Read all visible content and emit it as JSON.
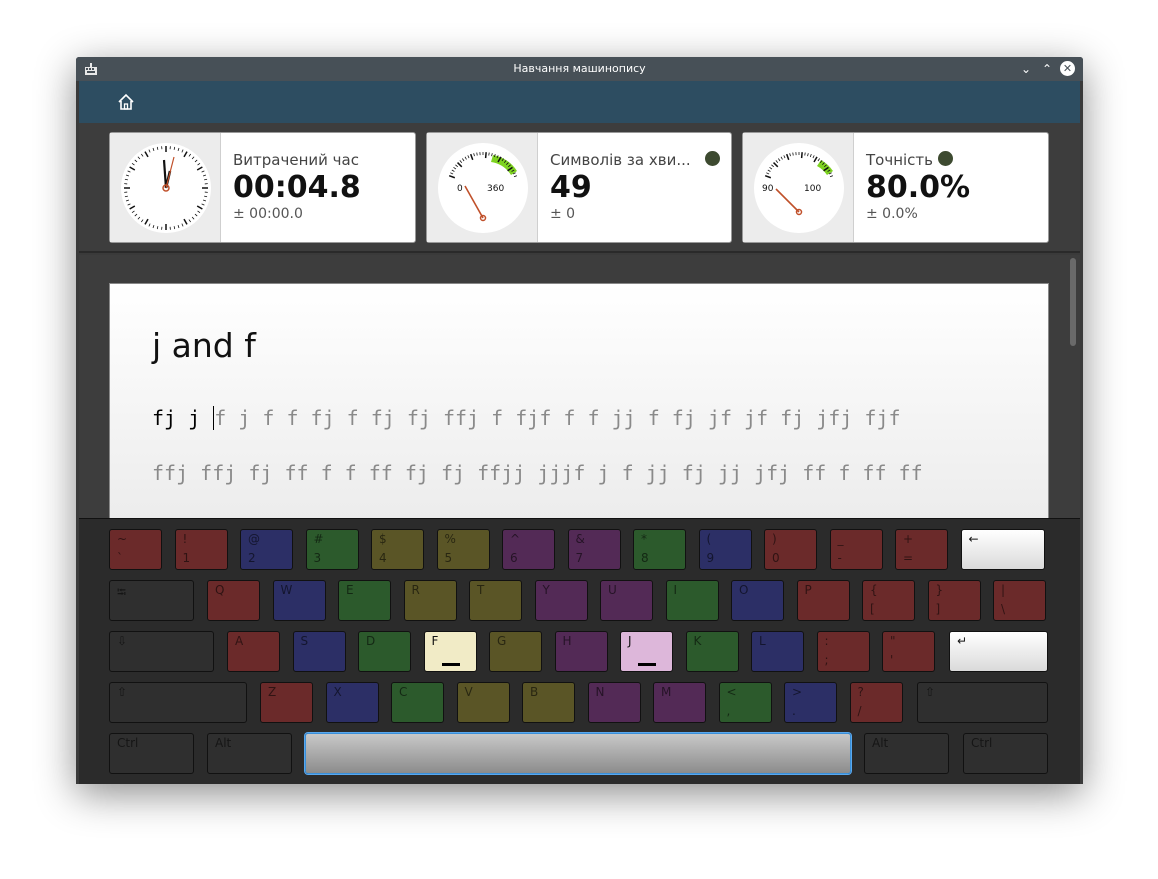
{
  "window": {
    "title": "Навчання машинопису",
    "controls": {
      "minimize": "⌄",
      "maximize": "⌃",
      "close": "✕"
    }
  },
  "toolbar": {
    "home_icon": "home-icon"
  },
  "stats": {
    "time": {
      "label": "Витрачений час",
      "value": "00:04.8",
      "deviation": "± 00:00.0"
    },
    "speed": {
      "label": "Символів за хви...",
      "value": "49",
      "deviation": "± 0",
      "gauge_min": "0",
      "gauge_max": "360"
    },
    "accuracy": {
      "label": "Точність",
      "value": "80.0%",
      "deviation": "± 0.0%",
      "gauge_min": "90",
      "gauge_max": "100"
    }
  },
  "lesson": {
    "title": "j and f",
    "typed": "fj j ",
    "remaining": "f j f f fj f fj fj ffj f fjf f f jj f fj jf jf fj jfj fjf",
    "line2": "ffj ffj fj ff f f ff fj fj ffjj jjjf j f jj fj jj jfj ff f ff ff"
  },
  "keyboard": {
    "row1": [
      {
        "t": "~",
        "b": "`"
      },
      {
        "t": "!",
        "b": "1"
      },
      {
        "t": "@",
        "b": "2"
      },
      {
        "t": "#",
        "b": "3"
      },
      {
        "t": "$",
        "b": "4"
      },
      {
        "t": "%",
        "b": "5"
      },
      {
        "t": "^",
        "b": "6"
      },
      {
        "t": "&",
        "b": "7"
      },
      {
        "t": "*",
        "b": "8"
      },
      {
        "t": "(",
        "b": "9"
      },
      {
        "t": ")",
        "b": "0"
      },
      {
        "t": "_",
        "b": "-"
      },
      {
        "t": "+",
        "b": "="
      },
      {
        "t": "←",
        "b": ""
      }
    ],
    "row2": [
      {
        "t": "⭾",
        "b": ""
      },
      {
        "t": "Q",
        "b": ""
      },
      {
        "t": "W",
        "b": ""
      },
      {
        "t": "E",
        "b": ""
      },
      {
        "t": "R",
        "b": ""
      },
      {
        "t": "T",
        "b": ""
      },
      {
        "t": "Y",
        "b": ""
      },
      {
        "t": "U",
        "b": ""
      },
      {
        "t": "I",
        "b": ""
      },
      {
        "t": "O",
        "b": ""
      },
      {
        "t": "P",
        "b": ""
      },
      {
        "t": "{",
        "b": "["
      },
      {
        "t": "}",
        "b": "]"
      },
      {
        "t": "|",
        "b": "\\"
      }
    ],
    "row3": [
      {
        "t": "⇩",
        "b": ""
      },
      {
        "t": "A",
        "b": ""
      },
      {
        "t": "S",
        "b": ""
      },
      {
        "t": "D",
        "b": ""
      },
      {
        "t": "F",
        "b": ""
      },
      {
        "t": "G",
        "b": ""
      },
      {
        "t": "H",
        "b": ""
      },
      {
        "t": "J",
        "b": ""
      },
      {
        "t": "K",
        "b": ""
      },
      {
        "t": "L",
        "b": ""
      },
      {
        "t": ":",
        "b": ";"
      },
      {
        "t": "\"",
        "b": "'"
      },
      {
        "t": "↵",
        "b": ""
      }
    ],
    "row4": [
      {
        "t": "⇧",
        "b": ""
      },
      {
        "t": "Z",
        "b": ""
      },
      {
        "t": "X",
        "b": ""
      },
      {
        "t": "C",
        "b": ""
      },
      {
        "t": "V",
        "b": ""
      },
      {
        "t": "B",
        "b": ""
      },
      {
        "t": "N",
        "b": ""
      },
      {
        "t": "M",
        "b": ""
      },
      {
        "t": "<",
        "b": ","
      },
      {
        "t": ">",
        "b": "."
      },
      {
        "t": "?",
        "b": "/"
      },
      {
        "t": "⇧",
        "b": ""
      }
    ],
    "row5": [
      {
        "t": "Ctrl",
        "b": ""
      },
      {
        "t": "Alt",
        "b": ""
      },
      {
        "t": "",
        "b": ""
      },
      {
        "t": "Alt",
        "b": ""
      },
      {
        "t": "Ctrl",
        "b": ""
      }
    ]
  },
  "colors": {
    "titlebar": "#475057",
    "toolbar": "#2d4d61",
    "accent": "#3a8fd8"
  }
}
